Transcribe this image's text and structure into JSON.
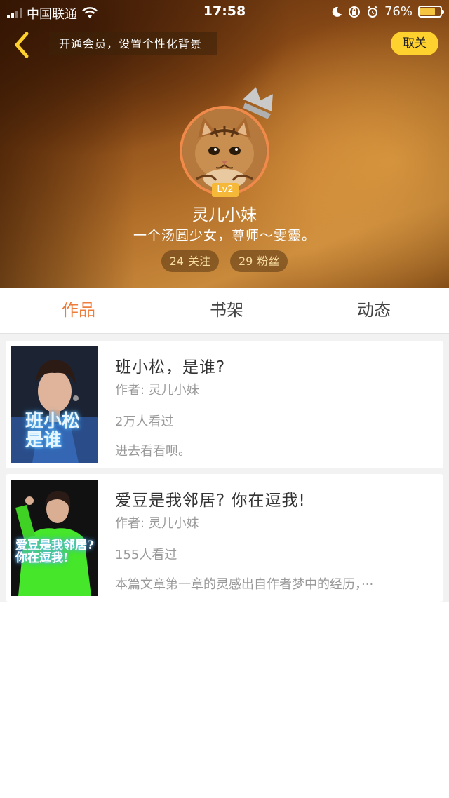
{
  "status_bar": {
    "carrier": "中国联通",
    "time": "17:58",
    "battery": "76%",
    "battery_level": 0.76
  },
  "header": {
    "vip_banner": "开通会员，设置个性化背景",
    "unfollow_label": "取关"
  },
  "profile": {
    "level": "Lv2",
    "username": "灵儿小妹",
    "signature": "一个汤圆少女，尊师～雯靈。",
    "following_count": "24",
    "following_label": "关注",
    "followers_count": "29",
    "followers_label": "粉丝"
  },
  "tabs": [
    {
      "label": "作品",
      "active": true
    },
    {
      "label": "书架",
      "active": false
    },
    {
      "label": "动态",
      "active": false
    }
  ],
  "works": [
    {
      "title": "班小松，是谁?",
      "author": "作者: 灵儿小妹",
      "views": "2万人看过",
      "description": "进去看看呗。",
      "cover_text": "班小松 是谁"
    },
    {
      "title": "爱豆是我邻居? 你在逗我!",
      "author": "作者: 灵儿小妹",
      "views": "155人看过",
      "description": "本篇文章第一章的灵感出自作者梦中的经历，···",
      "cover_text": "爱豆是我邻居? 你在逗我!"
    }
  ],
  "colors": {
    "accent": "#ee7c3a",
    "button_yellow": "#fed12e",
    "level_badge": "#f6b838"
  }
}
